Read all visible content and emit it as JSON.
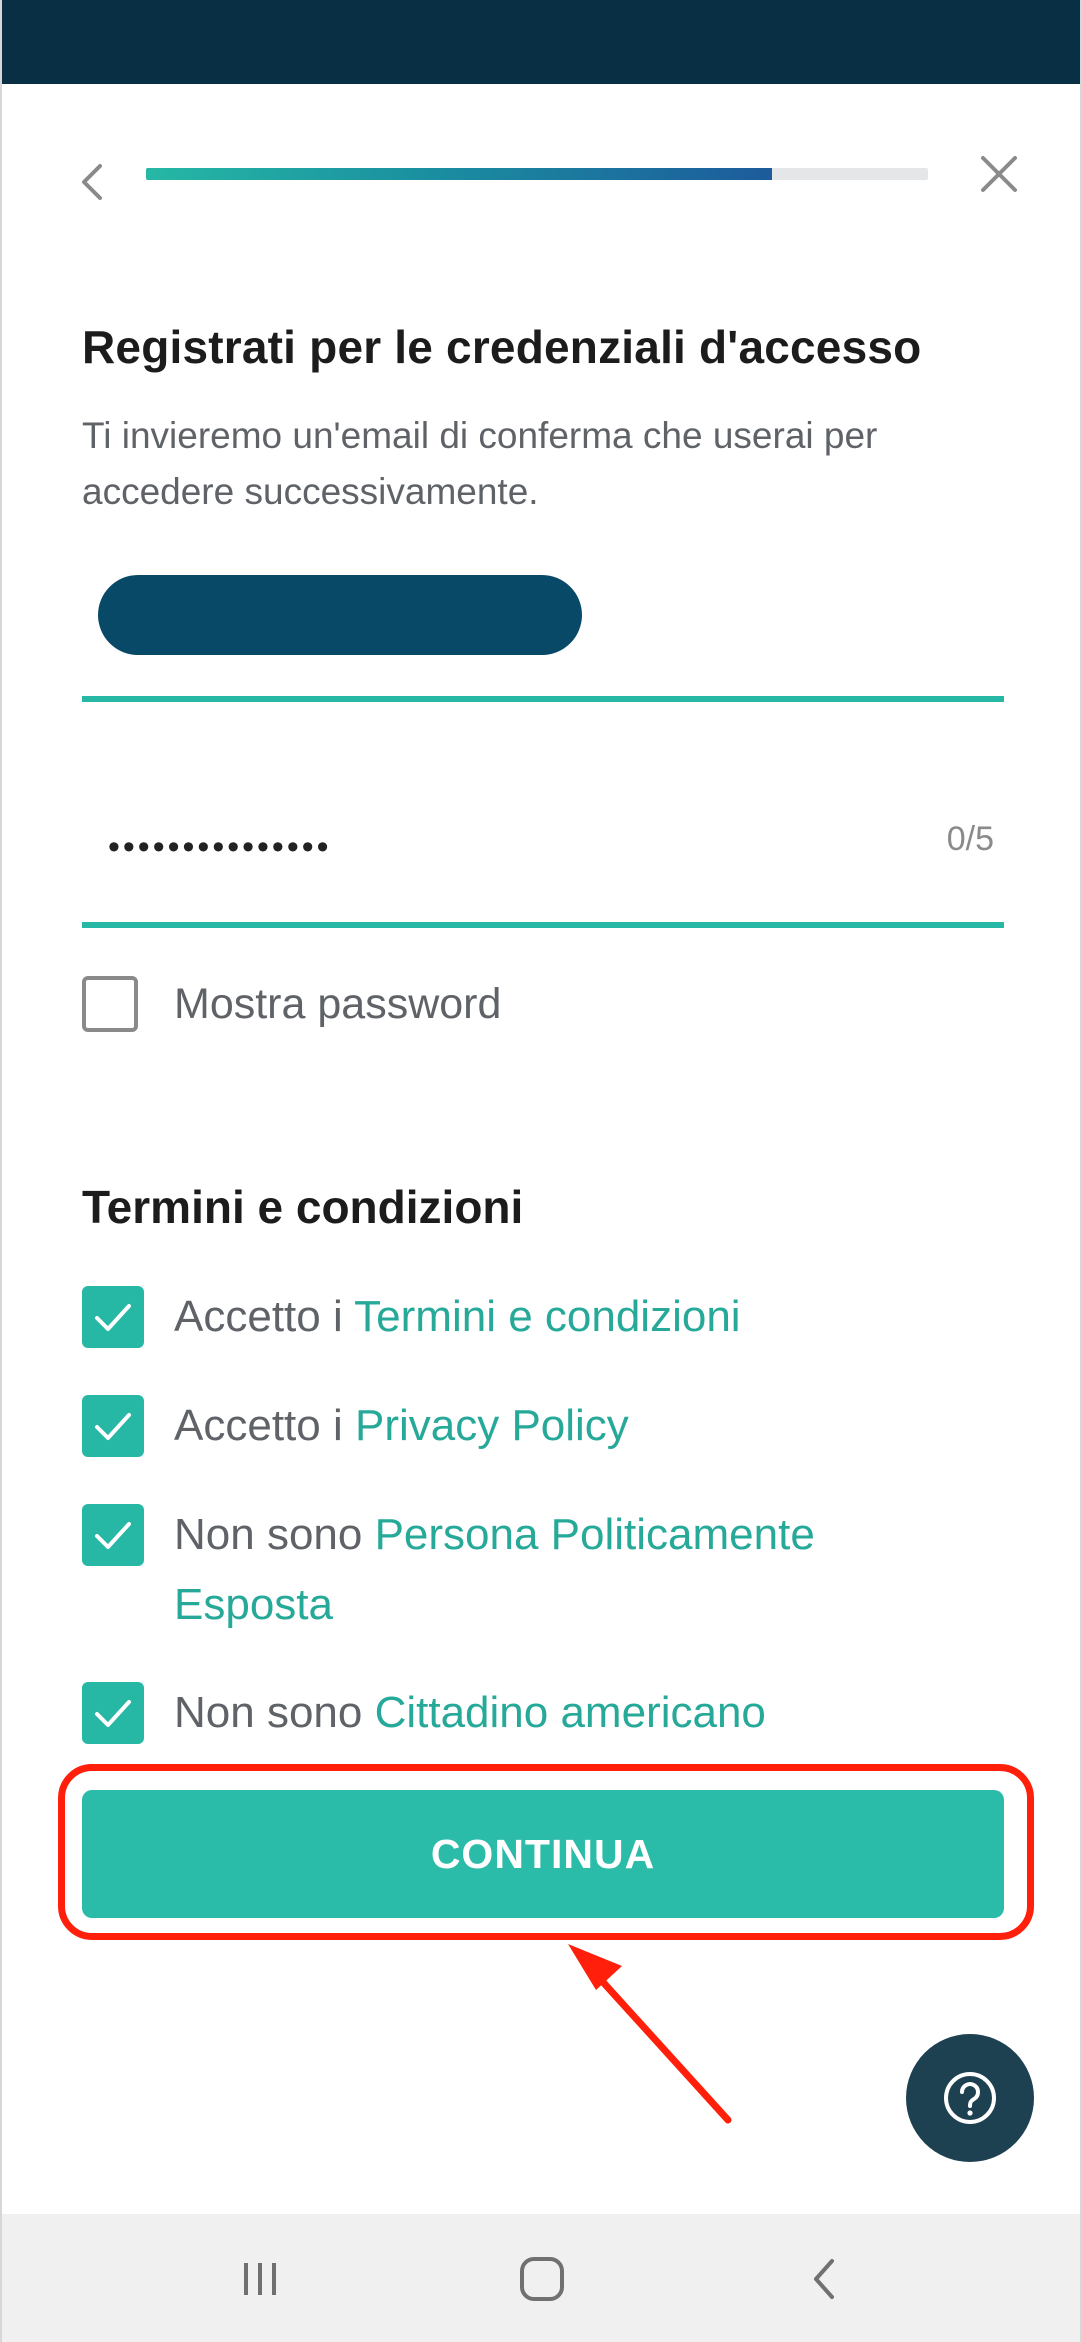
{
  "header": {
    "progress_fraction": 0.8
  },
  "form": {
    "title": "Registrati per le credenziali d'accesso",
    "subtitle": "Ti invieremo un'email di conferma che userai per accedere successivamente.",
    "password": {
      "value": "•••••••••••••••",
      "counter": "0/5"
    },
    "show_password_label": "Mostra password"
  },
  "terms": {
    "title": "Termini e condizioni",
    "items": [
      {
        "prefix": "Accetto i ",
        "link": "Termini e condizioni",
        "checked": true
      },
      {
        "prefix": "Accetto i ",
        "link": "Privacy Policy",
        "checked": true
      },
      {
        "prefix": "Non sono ",
        "link": "Persona Politicamente Esposta",
        "checked": true
      },
      {
        "prefix": "Non sono ",
        "link": "Cittadino americano",
        "checked": true
      }
    ]
  },
  "actions": {
    "continue_label": "CONTINUA"
  },
  "colors": {
    "accent": "#26b8a5",
    "status_bar": "#082f43",
    "annotation": "#ff1f0a",
    "help_button": "#1e4152"
  },
  "icons": {
    "back": "chevron-left-icon",
    "close": "close-icon",
    "help": "help-icon",
    "checkmark": "checkmark-icon"
  }
}
